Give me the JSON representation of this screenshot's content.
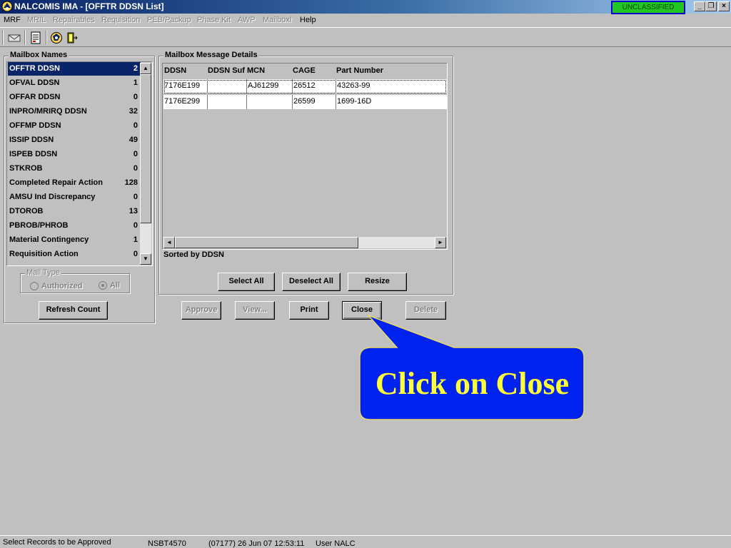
{
  "window": {
    "title": "NALCOMIS IMA - [OFFTR DDSN List]",
    "classification": "UNCLASSIFIED",
    "controls": {
      "minimize": "_",
      "restore": "❐",
      "close": "×"
    }
  },
  "menu": {
    "items": [
      {
        "label": "MRF",
        "enabled": true
      },
      {
        "label": "MRIL",
        "enabled": false
      },
      {
        "label": "Repairables",
        "enabled": false
      },
      {
        "label": "Requisition",
        "enabled": false
      },
      {
        "label": "PEB/Packup",
        "enabled": false
      },
      {
        "label": "Phase Kit",
        "enabled": false
      },
      {
        "label": "AWP",
        "enabled": false
      },
      {
        "label": "Mailbox!",
        "enabled": false
      },
      {
        "label": "Help",
        "enabled": true
      }
    ]
  },
  "toolbar": {
    "icons": [
      "mail-icon",
      "document-icon",
      "globe-icon",
      "exit-icon"
    ]
  },
  "mailbox": {
    "group_label": "Mailbox Names",
    "items": [
      {
        "name": "OFFTR DDSN",
        "count": "2"
      },
      {
        "name": "OFVAL DDSN",
        "count": "1"
      },
      {
        "name": "OFFAR DDSN",
        "count": "0"
      },
      {
        "name": "INPRO/MRIRQ DDSN",
        "count": "32"
      },
      {
        "name": "OFFMP DDSN",
        "count": "0"
      },
      {
        "name": "ISSIP DDSN",
        "count": "49"
      },
      {
        "name": "ISPEB DDSN",
        "count": "0"
      },
      {
        "name": "STKROB",
        "count": "0"
      },
      {
        "name": "Completed Repair Action",
        "count": "128"
      },
      {
        "name": "AMSU Ind Discrepancy",
        "count": "0"
      },
      {
        "name": "DTOROB",
        "count": "13"
      },
      {
        "name": "PBROB/PHROB",
        "count": "0"
      },
      {
        "name": "Material Contingency",
        "count": "1"
      },
      {
        "name": "Requisition Action",
        "count": "0"
      }
    ],
    "selected_index": 0,
    "mail_type": {
      "label": "Mail Type",
      "options": [
        "Authorized",
        "All"
      ],
      "selected": "All"
    },
    "refresh_label": "Refresh Count"
  },
  "details": {
    "group_label": "Mailbox Message Details",
    "columns": [
      "DDSN",
      "DDSN Suf",
      "MCN",
      "CAGE",
      "Part Number"
    ],
    "rows": [
      [
        "7176E199",
        "",
        "AJ61299",
        "26512",
        "43263-99"
      ],
      [
        "7176E299",
        "",
        "",
        "26599",
        "1699-16D"
      ]
    ],
    "sorted_label": "Sorted by DDSN",
    "buttons": {
      "select_all": "Select All",
      "deselect_all": "Deselect All",
      "resize": "Resize"
    }
  },
  "actions": {
    "approve": "Approve",
    "view": "View...",
    "print": "Print",
    "close": "Close",
    "delete": "Delete"
  },
  "callout": {
    "text": "Click on Close",
    "fill": "#0022ee",
    "text_color": "#ffff33"
  },
  "status": {
    "message": "Select Records to be Approved",
    "workstation": "NSBT4570",
    "datetime": "(07177)  26 Jun 07  12:53:11",
    "user": "User NALC"
  }
}
